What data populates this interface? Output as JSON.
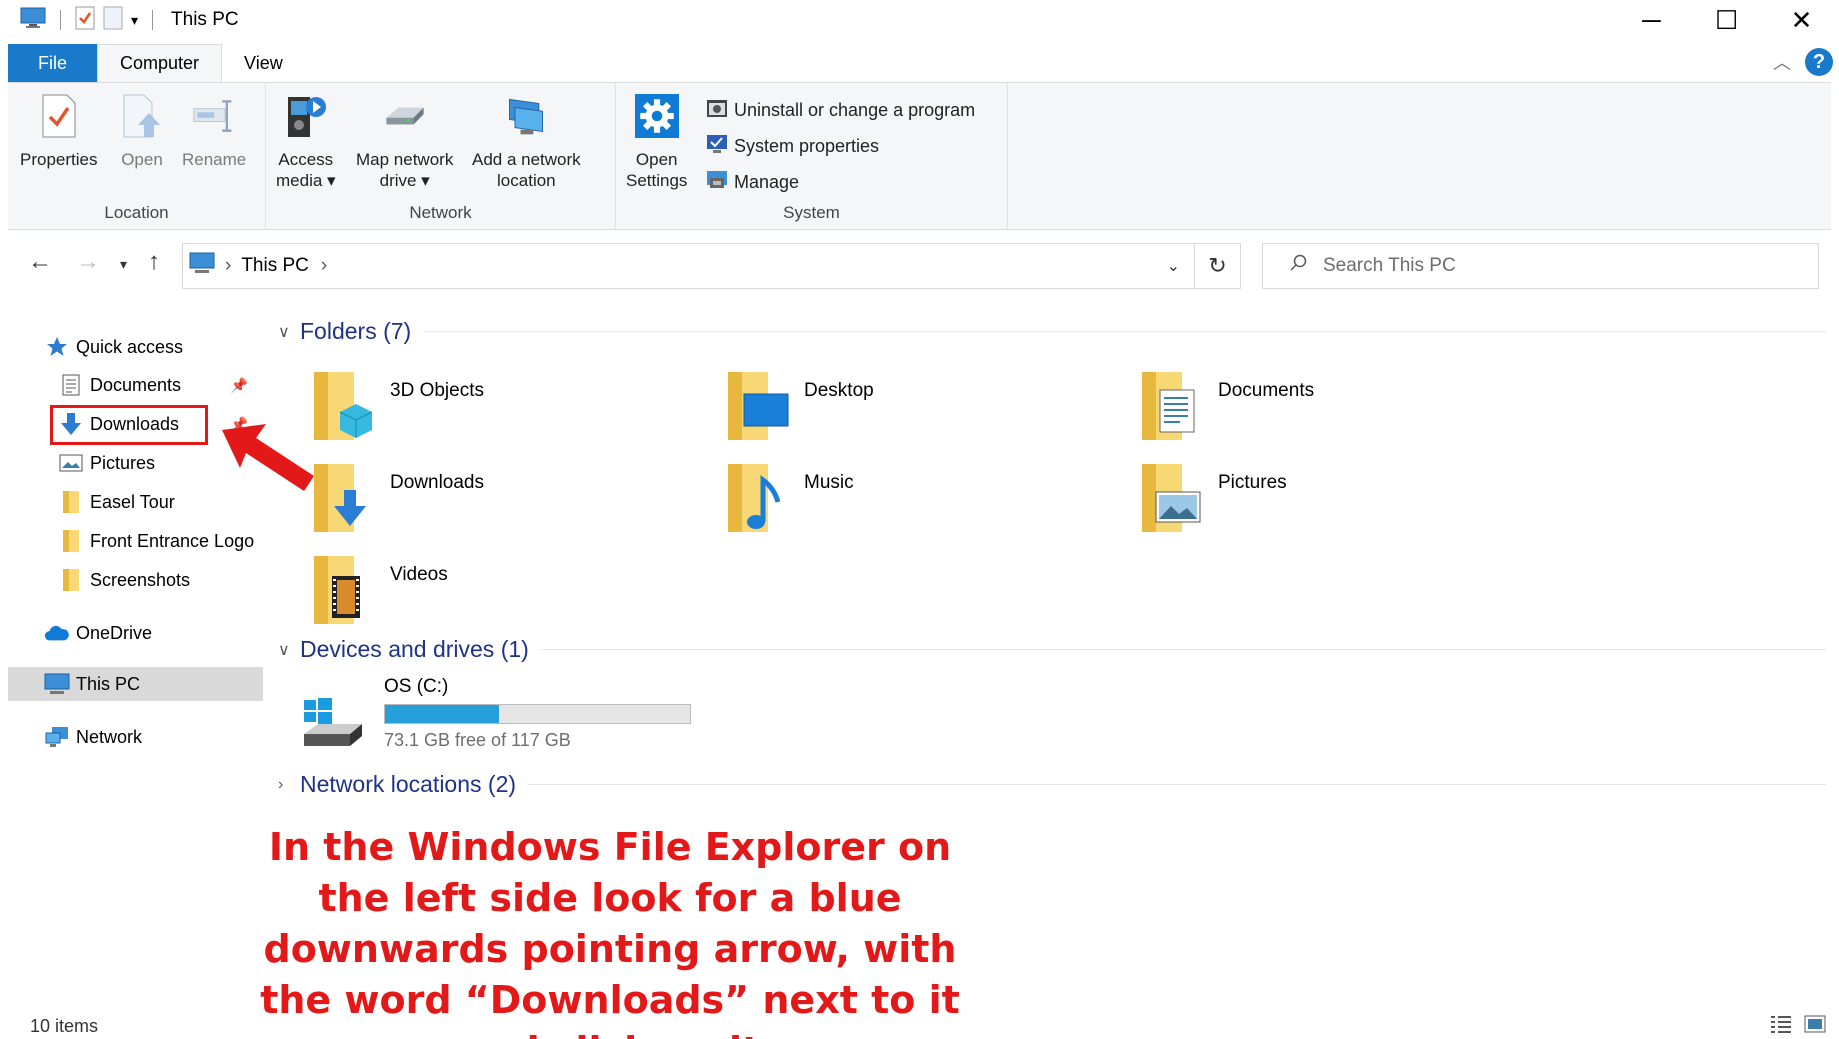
{
  "window": {
    "title": "This PC"
  },
  "ribbon_tabs": [
    "File",
    "Computer",
    "View"
  ],
  "ribbon": {
    "location_group": {
      "label": "Location",
      "properties": "Properties",
      "open": "Open",
      "rename": "Rename"
    },
    "network_group": {
      "label": "Network",
      "access_media": [
        "Access",
        "media ▾"
      ],
      "map_network_drive": [
        "Map network",
        "drive ▾"
      ],
      "add_network_location": [
        "Add a network",
        "location"
      ]
    },
    "system_group": {
      "label": "System",
      "open_settings": [
        "Open",
        "Settings"
      ],
      "uninstall": "Uninstall or change a program",
      "system_properties": "System properties",
      "manage": "Manage"
    }
  },
  "address": {
    "path": "This PC",
    "search_placeholder": "Search This PC"
  },
  "nav_pane": {
    "quick_access": "Quick access",
    "documents": "Documents",
    "downloads": "Downloads",
    "pictures": "Pictures",
    "easel_tour": "Easel Tour",
    "front_entrance": "Front Entrance Logo",
    "screenshots": "Screenshots",
    "onedrive": "OneDrive",
    "this_pc": "This PC",
    "network": "Network"
  },
  "content": {
    "folders_header": "Folders (7)",
    "folders": [
      "3D Objects",
      "Desktop",
      "Documents",
      "Downloads",
      "Music",
      "Pictures",
      "Videos"
    ],
    "devices_header": "Devices and drives (1)",
    "drive": {
      "name": "OS (C:)",
      "free_text": "73.1 GB free of 117 GB",
      "used_fraction": 0.375
    },
    "network_header": "Network locations (2)"
  },
  "annotation": {
    "text": "In the Windows File Explorer on the left side look for a blue downwards pointing arrow, with the word “Downloads” next to it and click on it"
  },
  "status": {
    "items_count": "10 items"
  },
  "colors": {
    "accent": "#1979ca",
    "annotation_red": "#e31919",
    "header_blue": "#1e3287",
    "drive_bar": "#26a0da"
  }
}
